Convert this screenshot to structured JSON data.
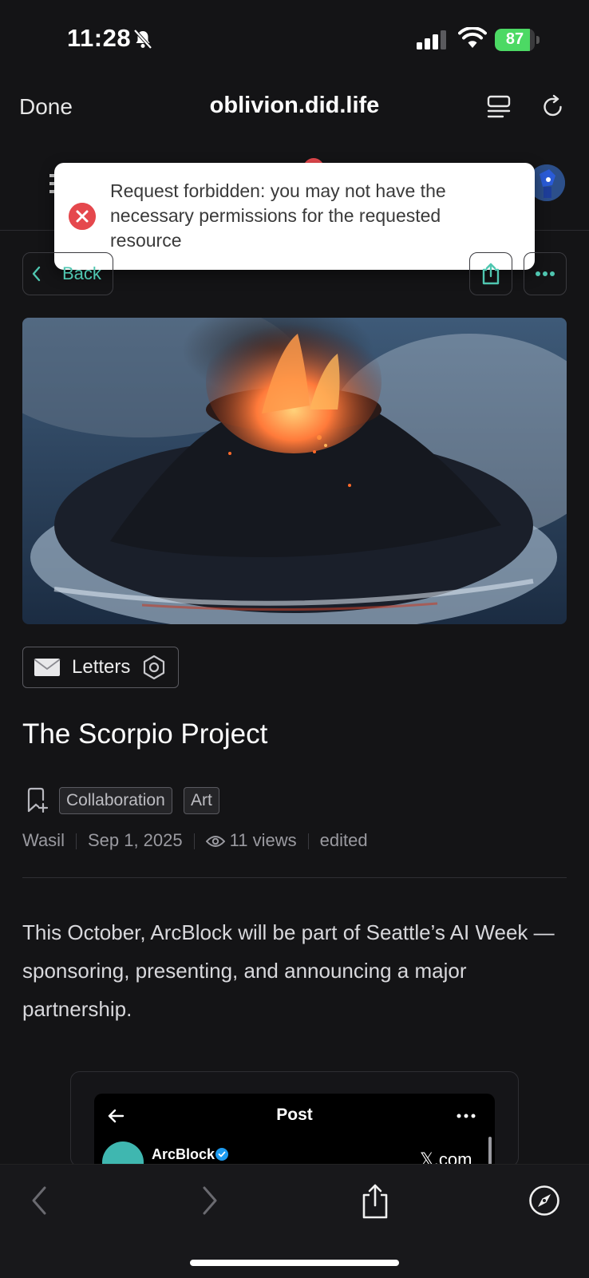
{
  "status_bar": {
    "time": "11:28",
    "battery": "87",
    "battery_level": 0.87
  },
  "browser": {
    "done_label": "Done",
    "site_title": "oblivion.did.life"
  },
  "toast": {
    "message": "Request forbidden: you may not have the necessary permissions for the requested resource"
  },
  "actions": {
    "back_label": "Back"
  },
  "post": {
    "category": "Letters",
    "title": "The Scorpio Project",
    "tags": [
      "Collaboration",
      "Art"
    ],
    "author": "Wasil",
    "date": "Sep 1, 2025",
    "views": "11 views",
    "edited": "edited",
    "body": "This October, ArcBlock will be part of Seattle’s AI Week — sponsoring, presenting, and announcing a major partnership."
  },
  "embed": {
    "header": "Post",
    "author": "ArcBlock",
    "domain": "𝕏.com"
  },
  "colors": {
    "background": "#141416",
    "accent": "#4fc6b0",
    "error": "#e5484d",
    "battery": "#4cd964"
  }
}
